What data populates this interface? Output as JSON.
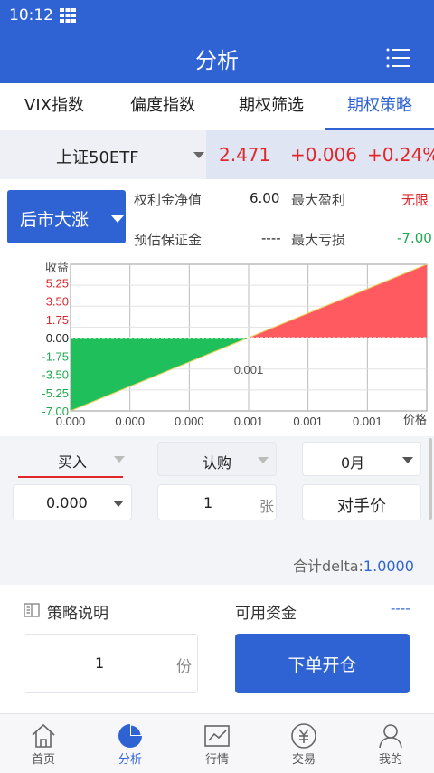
{
  "status": {
    "time": "10:12"
  },
  "header": {
    "title": "分析"
  },
  "tabs": [
    {
      "label": "VIX指数"
    },
    {
      "label": "偏度指数"
    },
    {
      "label": "期权筛选"
    },
    {
      "label": "期权策略",
      "active": true
    }
  ],
  "quote": {
    "name": "上证50ETF",
    "price": "2.471",
    "change": "+0.006",
    "percent": "+0.24%"
  },
  "strategy": {
    "selector": "后市大涨",
    "net_premium_label": "权利金净值",
    "net_premium_value": "6.00",
    "max_profit_label": "最大盈利",
    "max_profit_value": "无限",
    "margin_label": "预估保证金",
    "margin_value": "----",
    "max_loss_label": "最大亏损",
    "max_loss_value": "-7.00"
  },
  "chart_data": {
    "type": "area",
    "ylabel": "收益",
    "xlabel": "价格",
    "y_ticks": [
      "5.25",
      "3.50",
      "1.75",
      "0.00",
      "-1.75",
      "-3.50",
      "-5.25",
      "-7.00"
    ],
    "x_ticks": [
      "0.000",
      "0.000",
      "0.000",
      "0.001",
      "0.001",
      "0.001"
    ],
    "breakeven_label": "0.001",
    "ylim": [
      -7.0,
      7.0
    ],
    "series": [
      {
        "x": [
          0,
          1
        ],
        "y": [
          -7.0,
          0.0
        ]
      },
      {
        "x": [
          1,
          2
        ],
        "y": [
          0.0,
          7.0
        ]
      }
    ],
    "colors": {
      "loss": "#1fbf5b",
      "profit": "#ff5a5f"
    }
  },
  "form": {
    "direction": "买入",
    "type": "认购",
    "month": "0月",
    "strike": "0.000",
    "quantity": "1",
    "quantity_unit": "张",
    "counter_price": "对手价"
  },
  "delta": {
    "label": "合计delta:",
    "value": "1.0000"
  },
  "panel": {
    "explain_label": "策略说明",
    "funds_label": "可用资金",
    "funds_value": "----",
    "copies_value": "1",
    "copies_unit": "份",
    "submit_label": "下单开仓"
  },
  "nav": [
    {
      "label": "首页",
      "icon": "home-icon"
    },
    {
      "label": "分析",
      "icon": "pie-chart-icon",
      "active": true
    },
    {
      "label": "行情",
      "icon": "line-chart-icon"
    },
    {
      "label": "交易",
      "icon": "yuan-coin-icon"
    },
    {
      "label": "我的",
      "icon": "user-icon"
    }
  ],
  "colors": {
    "brand": "#2f63d3",
    "up": "#e0262a",
    "down": "#1fa84f"
  }
}
